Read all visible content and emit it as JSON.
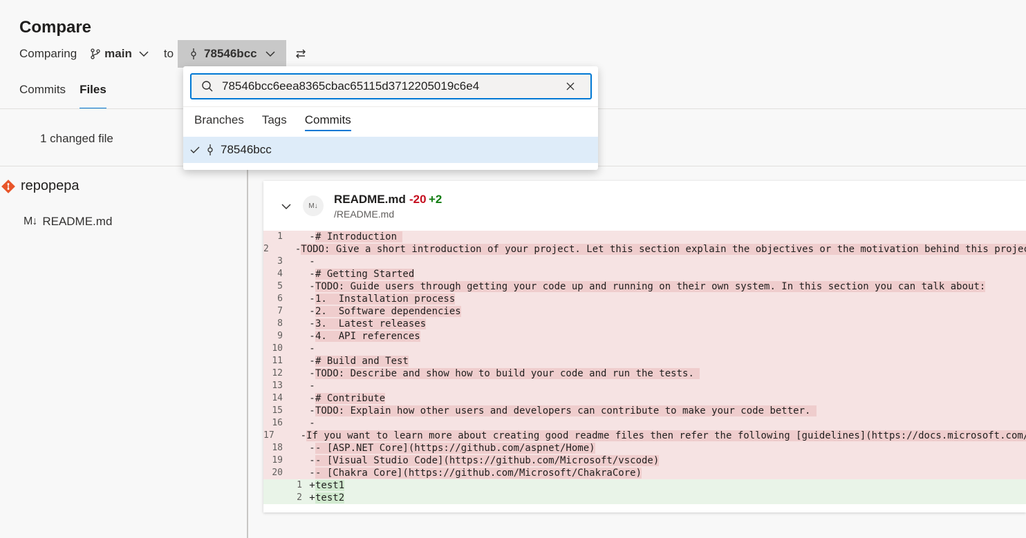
{
  "page": {
    "title": "Compare"
  },
  "compare": {
    "label": "Comparing",
    "source_branch": "main",
    "to_label": "to",
    "target_commit": "78546bcc"
  },
  "tabs": [
    {
      "label": "Commits",
      "active": false
    },
    {
      "label": "Files",
      "active": true
    }
  ],
  "summary": {
    "changed": "1 changed file"
  },
  "tree": {
    "repo": "repopepa",
    "files": [
      {
        "name": "README.md"
      }
    ]
  },
  "file": {
    "name": "README.md",
    "removed": "-20",
    "added": "+2",
    "path": "/README.md",
    "badge": "M↓",
    "lines": [
      {
        "old": "1",
        "new": "",
        "sign": "-",
        "text": "# Introduction ",
        "type": "del"
      },
      {
        "old": "2",
        "new": "",
        "sign": "-",
        "text": "TODO: Give a short introduction of your project. Let this section explain the objectives or the motivation behind this project.",
        "type": "del"
      },
      {
        "old": "3",
        "new": "",
        "sign": "-",
        "text": "",
        "type": "del"
      },
      {
        "old": "4",
        "new": "",
        "sign": "-",
        "text": "# Getting Started",
        "type": "del"
      },
      {
        "old": "5",
        "new": "",
        "sign": "-",
        "text": "TODO: Guide users through getting your code up and running on their own system. In this section you can talk about:",
        "type": "del"
      },
      {
        "old": "6",
        "new": "",
        "sign": "-",
        "text": "1.  Installation process",
        "type": "del"
      },
      {
        "old": "7",
        "new": "",
        "sign": "-",
        "text": "2.  Software dependencies",
        "type": "del"
      },
      {
        "old": "8",
        "new": "",
        "sign": "-",
        "text": "3.  Latest releases",
        "type": "del"
      },
      {
        "old": "9",
        "new": "",
        "sign": "-",
        "text": "4.  API references",
        "type": "del"
      },
      {
        "old": "10",
        "new": "",
        "sign": "-",
        "text": "",
        "type": "del"
      },
      {
        "old": "11",
        "new": "",
        "sign": "-",
        "text": "# Build and Test",
        "type": "del"
      },
      {
        "old": "12",
        "new": "",
        "sign": "-",
        "text": "TODO: Describe and show how to build your code and run the tests. ",
        "type": "del"
      },
      {
        "old": "13",
        "new": "",
        "sign": "-",
        "text": "",
        "type": "del"
      },
      {
        "old": "14",
        "new": "",
        "sign": "-",
        "text": "# Contribute",
        "type": "del"
      },
      {
        "old": "15",
        "new": "",
        "sign": "-",
        "text": "TODO: Explain how other users and developers can contribute to make your code better. ",
        "type": "del"
      },
      {
        "old": "16",
        "new": "",
        "sign": "-",
        "text": "",
        "type": "del"
      },
      {
        "old": "17",
        "new": "",
        "sign": "-",
        "text": "If you want to learn more about creating good readme files then refer the following [guidelines](https://docs.microsoft.com/en-us/azure/devops/repos/git/create-a-readme).",
        "type": "del"
      },
      {
        "old": "18",
        "new": "",
        "sign": "-",
        "text": "- [ASP.NET Core](https://github.com/aspnet/Home)",
        "type": "del"
      },
      {
        "old": "19",
        "new": "",
        "sign": "-",
        "text": "- [Visual Studio Code](https://github.com/Microsoft/vscode)",
        "type": "del"
      },
      {
        "old": "20",
        "new": "",
        "sign": "-",
        "text": "- [Chakra Core](https://github.com/Microsoft/ChakraCore)",
        "type": "del"
      },
      {
        "old": "",
        "new": "1",
        "sign": "+",
        "text": "test1",
        "type": "ins"
      },
      {
        "old": "",
        "new": "2",
        "sign": "+",
        "text": "test2",
        "type": "ins"
      }
    ]
  },
  "dropdown": {
    "search_value": "78546bcc6eea8365cbac65115d3712205019c6e4",
    "tabs": [
      {
        "label": "Branches",
        "active": false
      },
      {
        "label": "Tags",
        "active": false
      },
      {
        "label": "Commits",
        "active": true
      }
    ],
    "selected_item": "78546bcc"
  },
  "colors": {
    "accent": "#0078d4",
    "removed": "#c50f1f",
    "added": "#107c10",
    "del_bg": "#f6e3e3",
    "ins_bg": "#e9f4e8",
    "selected_bg": "#deecf9"
  }
}
